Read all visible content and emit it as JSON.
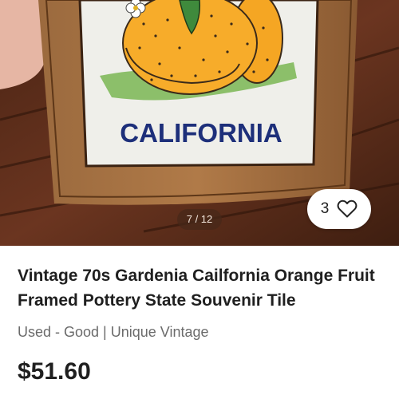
{
  "gallery": {
    "tile_text": "CALIFORNIA",
    "counter": "7 / 12",
    "like_count": "3",
    "icons": {
      "like": "heart-outline-icon"
    }
  },
  "listing": {
    "title": "Vintage 70s Gardenia Cailfornia Orange Fruit Framed Pottery State Souvenir Tile",
    "condition": "Used - Good | Unique Vintage",
    "price": "$51.60"
  },
  "colors": {
    "tile_text": "#1d2f7a",
    "orange": "#f5a623",
    "frame": "#8a5a32"
  }
}
